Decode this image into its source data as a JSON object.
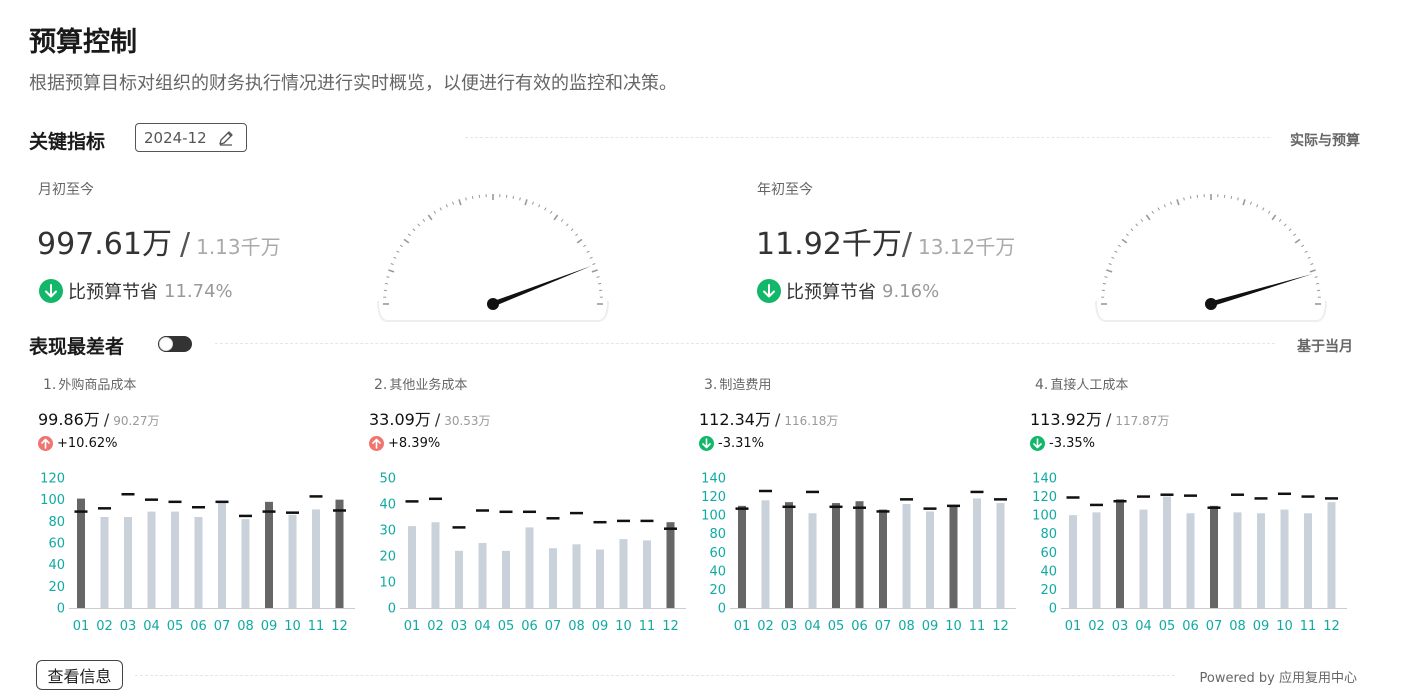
{
  "header": {
    "title": "预算控制",
    "subtitle": "根据预算目标对组织的财务执行情况进行实时概览，以便进行有效的监控和决策。"
  },
  "key_metrics": {
    "title": "关键指标",
    "date": "2024-12",
    "right_label": "实际与预算",
    "mtd": {
      "label": "月初至今",
      "actual": "997.61万",
      "separator": "/",
      "budget": "1.13千万",
      "compare_label": "比预算节省",
      "compare_pct": "11.74%",
      "direction": "down",
      "gauge_ratio": 0.8826
    },
    "ytd": {
      "label": "年初至今",
      "actual": "11.92千万",
      "separator": "/",
      "budget": "13.12千万",
      "compare_label": "比预算节省",
      "compare_pct": "9.16%",
      "direction": "down",
      "gauge_ratio": 0.9084
    }
  },
  "worst": {
    "title": "表现最差者",
    "toggle_on": true,
    "right_label": "基于当月"
  },
  "colors": {
    "over_budget_bar": "#666666",
    "under_budget_bar": "#c9d2da",
    "budget_marker": "#111111",
    "axis_text": "#10aaa2",
    "down_badge": "#12b76a",
    "up_badge": "#f07470"
  },
  "chart_data": [
    {
      "type": "bar",
      "rank": "1.",
      "name": "外购商品成本",
      "actual": "99.86万",
      "separator": "/",
      "budget": "90.27万",
      "change": "+10.62%",
      "direction": "up",
      "categories": [
        "01",
        "02",
        "03",
        "04",
        "05",
        "06",
        "07",
        "08",
        "09",
        "10",
        "11",
        "12"
      ],
      "ylim": [
        0,
        120
      ],
      "yticks": [
        0,
        20,
        40,
        60,
        80,
        100,
        120
      ],
      "series": [
        {
          "name": "",
          "values": [
            101,
            84,
            84,
            89,
            89,
            84,
            97,
            82,
            98,
            86,
            91,
            100
          ]
        },
        {
          "name": "",
          "values": [
            89,
            92,
            105,
            100,
            98,
            93,
            98,
            85,
            89,
            88,
            103,
            90
          ]
        }
      ]
    },
    {
      "type": "bar",
      "rank": "2.",
      "name": "其他业务成本",
      "actual": "33.09万",
      "separator": "/",
      "budget": "30.53万",
      "change": "+8.39%",
      "direction": "up",
      "categories": [
        "01",
        "02",
        "03",
        "04",
        "05",
        "06",
        "07",
        "08",
        "09",
        "10",
        "11",
        "12"
      ],
      "ylim": [
        0,
        50
      ],
      "yticks": [
        0,
        10,
        20,
        30,
        40,
        50
      ],
      "series": [
        {
          "name": "",
          "values": [
            31.5,
            33,
            22,
            25,
            22,
            31,
            23,
            24.5,
            22.5,
            26.5,
            26,
            33
          ]
        },
        {
          "name": "",
          "values": [
            41,
            42,
            31,
            37.5,
            37,
            37,
            34.5,
            36.5,
            33,
            33.5,
            33.5,
            30.5
          ]
        }
      ]
    },
    {
      "type": "bar",
      "rank": "3.",
      "name": "制造费用",
      "actual": "112.34万",
      "separator": "/",
      "budget": "116.18万",
      "change": "-3.31%",
      "direction": "down",
      "categories": [
        "01",
        "02",
        "03",
        "04",
        "05",
        "06",
        "07",
        "08",
        "09",
        "10",
        "11",
        "12"
      ],
      "ylim": [
        0,
        140
      ],
      "yticks": [
        0,
        20,
        40,
        60,
        80,
        100,
        120,
        140
      ],
      "series": [
        {
          "name": "",
          "values": [
            110,
            116,
            114,
            102,
            113,
            115,
            106,
            112,
            104,
            111,
            118,
            113
          ]
        },
        {
          "name": "",
          "values": [
            107,
            126,
            109,
            125,
            109,
            108,
            104,
            117,
            107,
            110,
            125,
            117
          ]
        }
      ]
    },
    {
      "type": "bar",
      "rank": "4.",
      "name": "直接人工成本",
      "actual": "113.92万",
      "separator": "/",
      "budget": "117.87万",
      "change": "-3.35%",
      "direction": "down",
      "categories": [
        "01",
        "02",
        "03",
        "04",
        "05",
        "06",
        "07",
        "08",
        "09",
        "10",
        "11",
        "12"
      ],
      "ylim": [
        0,
        140
      ],
      "yticks": [
        0,
        20,
        40,
        60,
        80,
        100,
        120,
        140
      ],
      "series": [
        {
          "name": "",
          "values": [
            100,
            103,
            117,
            106,
            120,
            102,
            110,
            103,
            102,
            106,
            102,
            114
          ]
        },
        {
          "name": "",
          "values": [
            119,
            111,
            115,
            120,
            122,
            121,
            108,
            122,
            118,
            123,
            120,
            118
          ]
        }
      ]
    }
  ],
  "footer": {
    "view_info_label": "查看信息",
    "powered_by": "Powered by 应用复用中心"
  }
}
